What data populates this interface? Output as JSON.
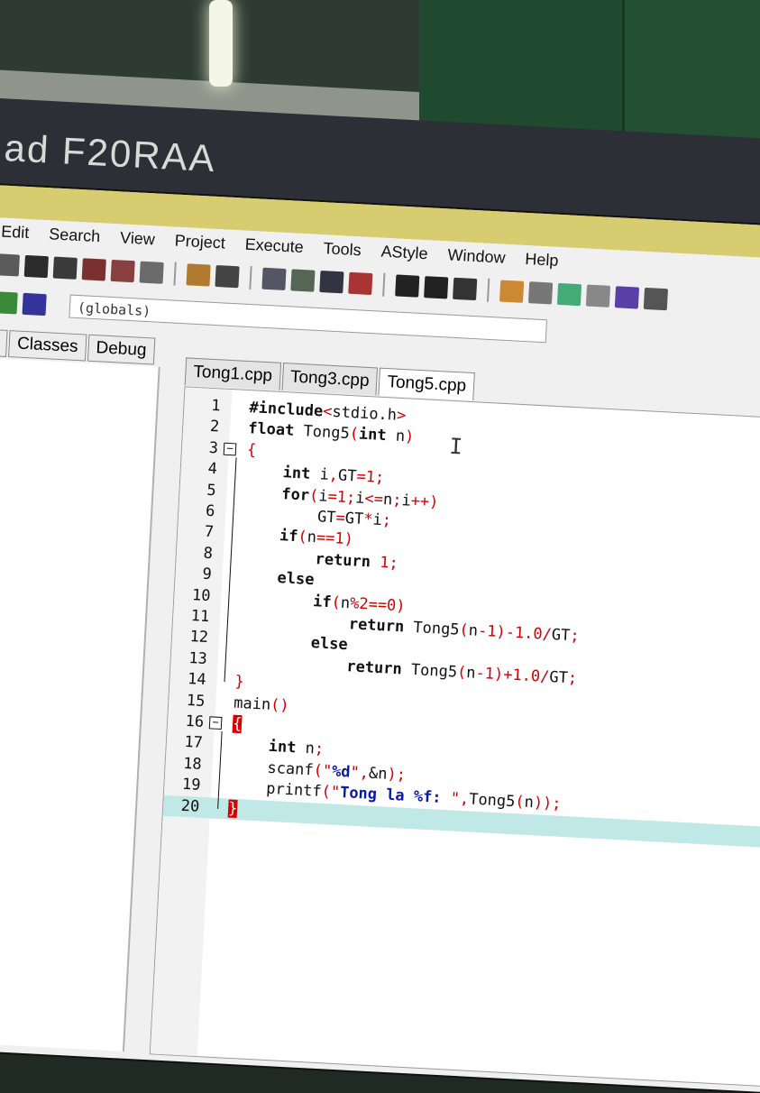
{
  "monitor": {
    "brand": "ad F20RAA"
  },
  "menu": [
    "Edit",
    "Search",
    "View",
    "Project",
    "Execute",
    "Tools",
    "AStyle",
    "Window",
    "Help"
  ],
  "scope_select": {
    "value": "(globals)"
  },
  "left_tabs": [
    "t",
    "Classes",
    "Debug"
  ],
  "editor_tabs": [
    {
      "label": "Tong1.cpp",
      "active": false
    },
    {
      "label": "Tong3.cpp",
      "active": false
    },
    {
      "label": "Tong5.cpp",
      "active": true
    }
  ],
  "code_lines": [
    {
      "n": "1",
      "text": "#include<stdio.h>"
    },
    {
      "n": "2",
      "text": "float Tong5(int n)"
    },
    {
      "n": "3",
      "text": "{"
    },
    {
      "n": "4",
      "text": "    int i,GT=1;"
    },
    {
      "n": "5",
      "text": "    for(i=1;i<=n;i++)"
    },
    {
      "n": "6",
      "text": "        GT=GT*i;"
    },
    {
      "n": "7",
      "text": "    if(n==1)"
    },
    {
      "n": "8",
      "text": "        return 1;"
    },
    {
      "n": "9",
      "text": "    else"
    },
    {
      "n": "10",
      "text": "        if(n%2==0)"
    },
    {
      "n": "11",
      "text": "            return Tong5(n-1)-1.0/GT;"
    },
    {
      "n": "12",
      "text": "        else"
    },
    {
      "n": "13",
      "text": "            return Tong5(n-1)+1.0/GT;"
    },
    {
      "n": "14",
      "text": "}"
    },
    {
      "n": "15",
      "text": "main()"
    },
    {
      "n": "16",
      "text": "{"
    },
    {
      "n": "17",
      "text": "    int n;"
    },
    {
      "n": "18",
      "text": "    scanf(\"%d\",&n);"
    },
    {
      "n": "19",
      "text": "    printf(\"Tong la %f: \",Tong5(n));"
    },
    {
      "n": "20",
      "text": "}"
    }
  ],
  "highlighted_line": "20",
  "colors": {
    "keyword": "#111111",
    "operator": "#d40000",
    "string": "#0a1aa8",
    "current_line": "#bfe8e6"
  }
}
